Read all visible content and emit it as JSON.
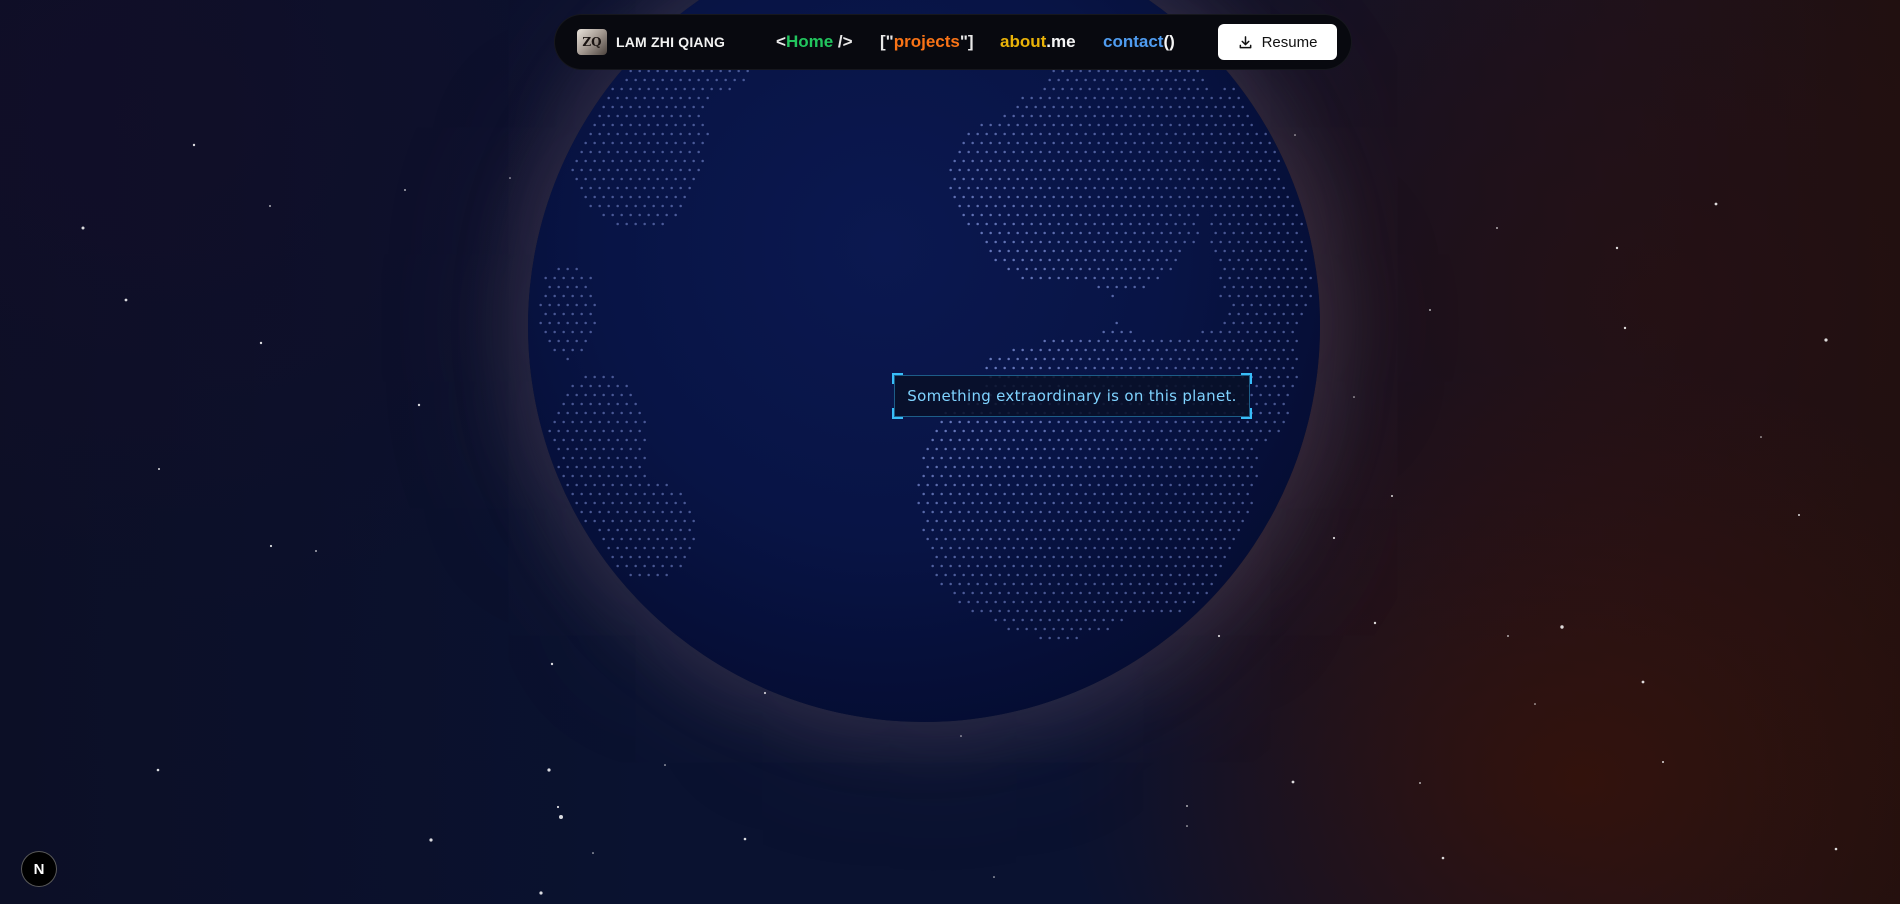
{
  "navbar": {
    "brand_name": "LAM ZHI QIANG",
    "logo_text": "ZQ",
    "links": {
      "home": {
        "pre": "<",
        "word": "Home",
        "post": " />"
      },
      "projects": {
        "pre": "[\"",
        "word": "projects",
        "post": "\"]"
      },
      "about": {
        "word": "about",
        "suffix": ".me"
      },
      "contact": {
        "word": "contact",
        "suffix": "()"
      }
    },
    "resume_label": "Resume"
  },
  "globe": {
    "tooltip_text": "Something extraordinary is on this planet."
  },
  "next_badge_letter": "N",
  "colors": {
    "home": "#22c55e",
    "projects": "#f97316",
    "about": "#eab308",
    "contact": "#4f9cf0",
    "tooltip": "#7fd3ff",
    "globe": "#081445"
  },
  "icons": {
    "resume": "download-icon",
    "badge": "nextjs-icon"
  }
}
